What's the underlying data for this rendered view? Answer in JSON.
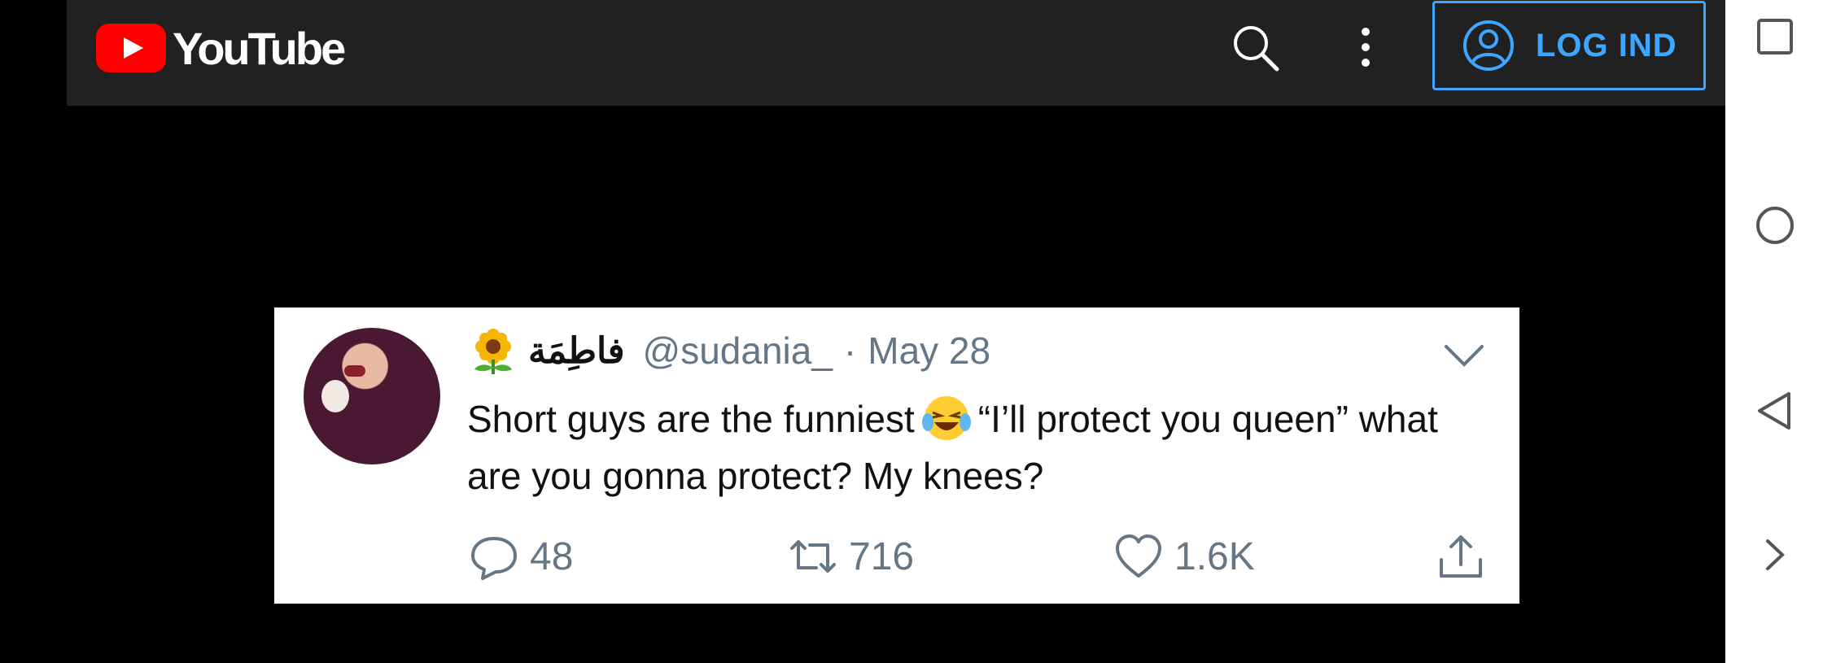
{
  "app": {
    "logo_text": "YouTube",
    "accent": "#ff0000",
    "login_label": "LOG IND",
    "login_color": "#3ea6ff"
  },
  "icons": [
    "search-icon",
    "more-vert-icon",
    "account-icon",
    "square-icon",
    "circle-icon",
    "back-triangle-icon",
    "chevron-right-icon"
  ],
  "tweet": {
    "display_name": "فاطِمَة",
    "handle": "@sudania_",
    "separator": "·",
    "date": "May 28",
    "text_part1": "Short guys are the funniest",
    "text_part2": "“I’ll protect you queen” what are you gonna protect? My knees?",
    "replies": "48",
    "retweets": "716",
    "likes": "1.6K"
  }
}
